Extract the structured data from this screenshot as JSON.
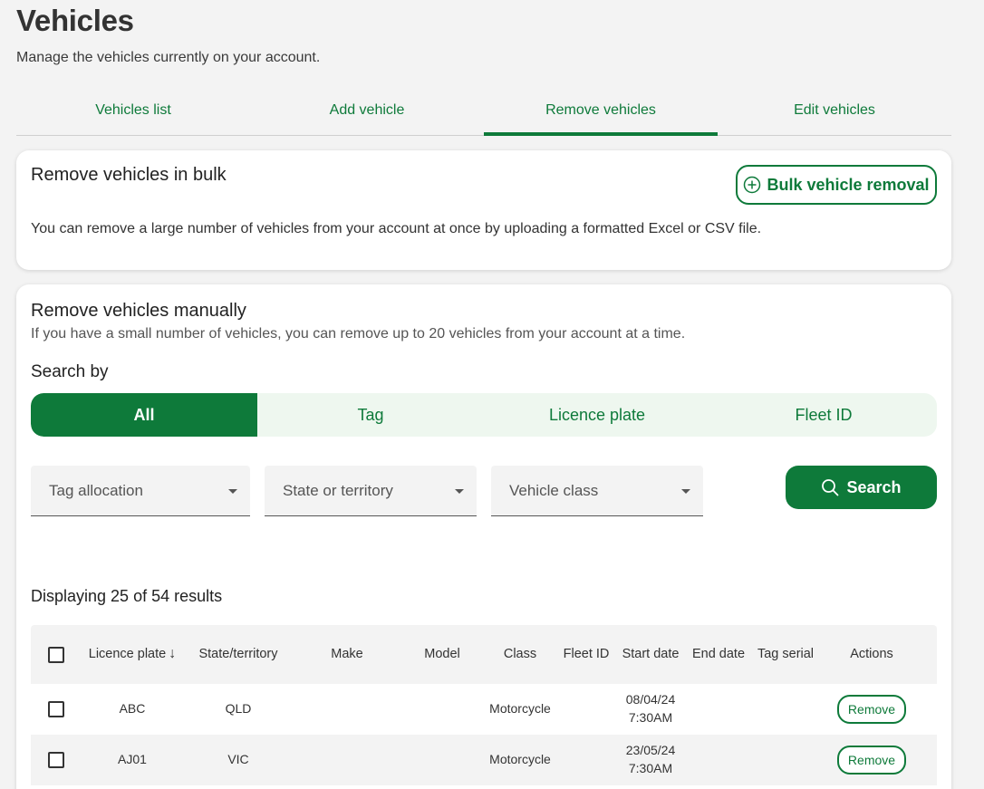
{
  "page": {
    "title": "Vehicles",
    "subtitle": "Manage the vehicles currently on your account."
  },
  "tabs": [
    {
      "label": "Vehicles list"
    },
    {
      "label": "Add vehicle"
    },
    {
      "label": "Remove vehicles",
      "active": true
    },
    {
      "label": "Edit vehicles"
    }
  ],
  "bulk": {
    "title": "Remove vehicles in bulk",
    "button_label": "Bulk vehicle removal",
    "button_icon": "plus-circle-icon",
    "description": "You can remove a large number of vehicles from your account at once by uploading a formatted Excel or CSV file."
  },
  "manual": {
    "title": "Remove vehicles manually",
    "description": "If you have a small number of vehicles, you can remove up to 20 vehicles from your account at a time.",
    "search_by_label": "Search by",
    "segments": [
      "All",
      "Tag",
      "Licence plate",
      "Fleet ID"
    ],
    "filters": {
      "tag_allocation": "Tag allocation",
      "state": "State or territory",
      "vehicle_class": "Vehicle class"
    },
    "search_button": "Search",
    "results_text": "Displaying 25 of 54 results"
  },
  "table": {
    "headers": {
      "licence_plate": "Licence plate",
      "sort_icon": "↓",
      "state": "State/territory",
      "make": "Make",
      "model": "Model",
      "class": "Class",
      "fleet_id": "Fleet ID",
      "start_date": "Start date",
      "end_date": "End date",
      "tag_serial": "Tag serial",
      "actions": "Actions"
    },
    "rows": [
      {
        "plate": "ABC",
        "state": "QLD",
        "make": "",
        "model": "",
        "class": "Motorcycle",
        "fleet_id": "",
        "start_date": "08/04/24",
        "start_time": "7:30AM",
        "end_date": "",
        "tag_serial": "",
        "action": "Remove"
      },
      {
        "plate": "AJ01",
        "state": "VIC",
        "make": "",
        "model": "",
        "class": "Motorcycle",
        "fleet_id": "",
        "start_date": "23/05/24",
        "start_time": "7:30AM",
        "end_date": "",
        "tag_serial": "",
        "action": "Remove"
      }
    ]
  },
  "colors": {
    "brand_green": "#0e7a3a",
    "segment_bg": "#eef7ef",
    "page_bg": "#f3f3f3"
  }
}
